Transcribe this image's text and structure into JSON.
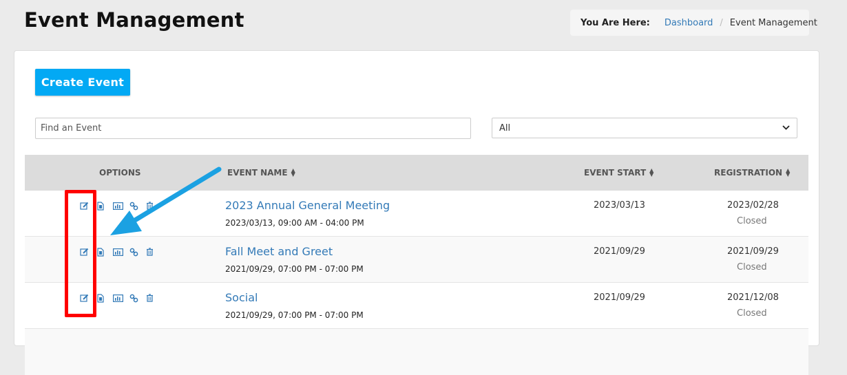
{
  "page": {
    "title": "Event Management"
  },
  "breadcrumb": {
    "label": "You Are Here:",
    "dashboard": "Dashboard",
    "separator": "/",
    "current": "Event Management"
  },
  "toolbar": {
    "create_label": "Create Event"
  },
  "search": {
    "placeholder": "Find an Event",
    "value": ""
  },
  "filter": {
    "selected": "All"
  },
  "table": {
    "headers": {
      "options": "OPTIONS",
      "event_name": "EVENT NAME",
      "event_start": "EVENT START",
      "registration": "REGISTRATION"
    },
    "rows": [
      {
        "name": "2023 Annual General Meeting",
        "time": "2023/03/13, 09:00 AM - 04:00 PM",
        "start": "2023/03/13",
        "reg_date": "2023/02/28",
        "reg_status": "Closed"
      },
      {
        "name": "Fall Meet and Greet",
        "time": "2021/09/29, 07:00 PM - 07:00 PM",
        "start": "2021/09/29",
        "reg_date": "2021/09/29",
        "reg_status": "Closed"
      },
      {
        "name": "Social",
        "time": "2021/09/29, 07:00 PM - 07:00 PM",
        "start": "2021/09/29",
        "reg_date": "2021/12/08",
        "reg_status": "Closed"
      }
    ]
  },
  "icons": [
    "edit-icon",
    "copy-icon",
    "report-icon",
    "link-icon",
    "trash-icon"
  ],
  "colors": {
    "accent": "#03a9f4",
    "link": "#337ab7",
    "highlight": "#ff0000",
    "arrow": "#1ba1e2"
  }
}
